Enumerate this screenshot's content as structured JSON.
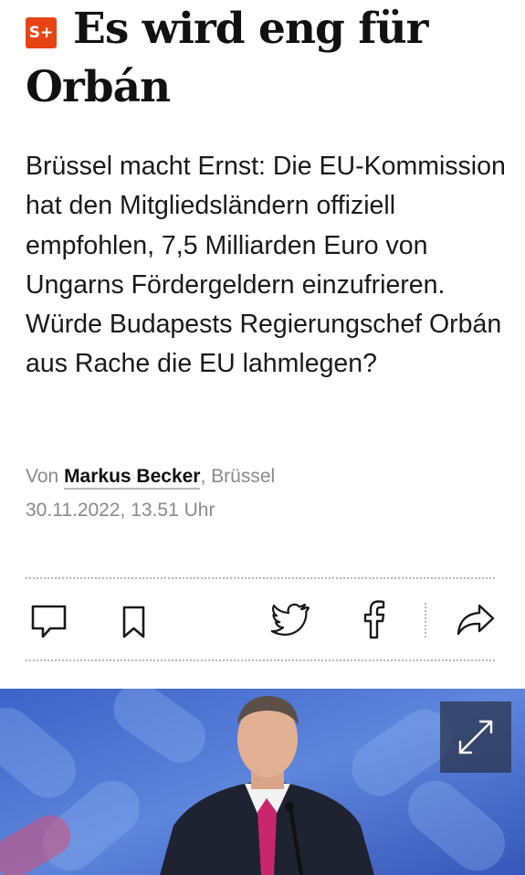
{
  "article": {
    "badge": "S+",
    "headline": "Es wird eng für Orbán",
    "teaser": "Brüssel macht Ernst: Die EU-Kommission hat den Mitgliedsländern offiziell empfohlen, 7,5 Milliarden Euro von Ungarns Fördergeldern einzufrieren. Würde Budapests Regierungschef Orbán aus Rache die EU lahmlegen?",
    "byline_prefix": "Von",
    "author": "Markus Becker",
    "location": ", Brüssel",
    "date": "30.11.2022, 13.51 Uhr"
  },
  "actions": {
    "comment": "comment-icon",
    "bookmark": "bookmark-icon",
    "twitter": "twitter-icon",
    "facebook": "facebook-icon",
    "share": "share-icon"
  },
  "colors": {
    "badge": "#e64415",
    "image_background": "#4a6fd0"
  }
}
